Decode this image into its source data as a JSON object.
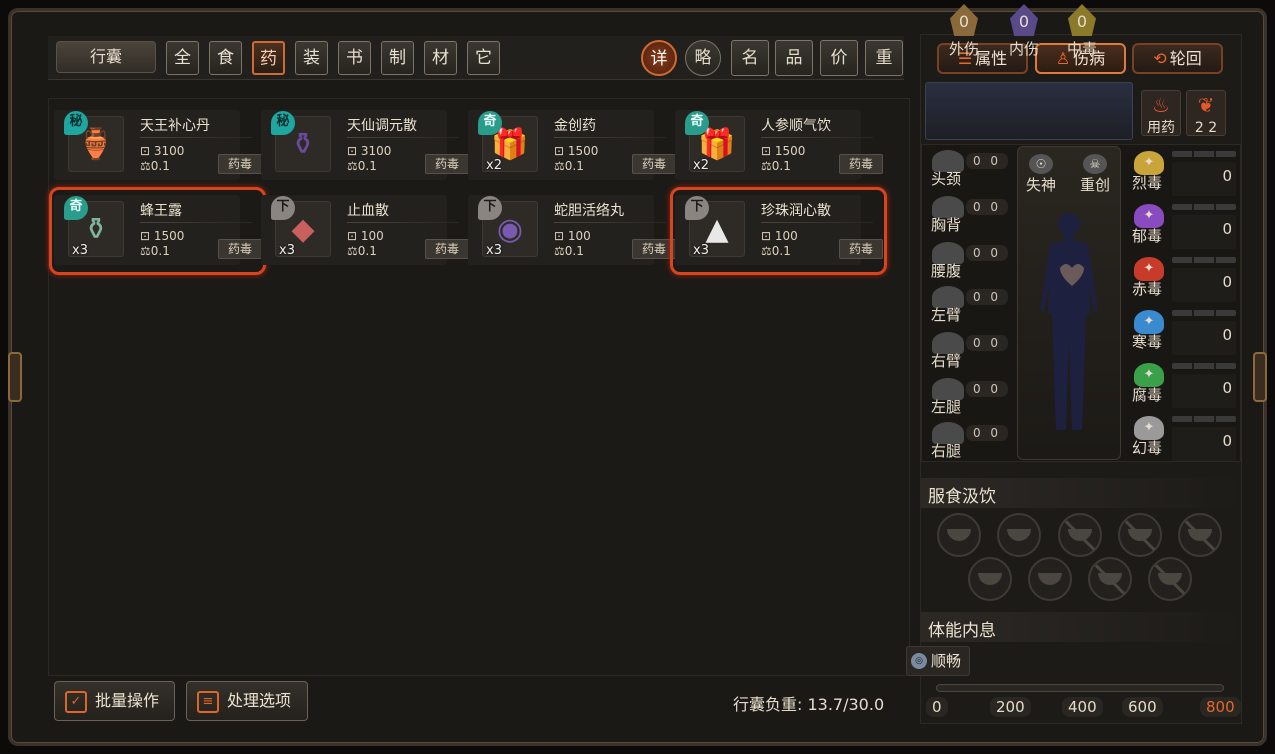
{
  "bag_tag": "行囊",
  "category_tabs": [
    {
      "label": "全",
      "active": false
    },
    {
      "label": "食",
      "active": false
    },
    {
      "label": "药",
      "active": true
    },
    {
      "label": "装",
      "active": false
    },
    {
      "label": "书",
      "active": false
    },
    {
      "label": "制",
      "active": false
    },
    {
      "label": "材",
      "active": false
    },
    {
      "label": "它",
      "active": false
    }
  ],
  "view_buttons": [
    {
      "label": "详",
      "active": true
    },
    {
      "label": "略",
      "active": false
    },
    {
      "label": "名",
      "active": false
    },
    {
      "label": "品",
      "active": false
    },
    {
      "label": "价",
      "active": false
    },
    {
      "label": "重",
      "active": false
    }
  ],
  "items": [
    {
      "name": "天王补心丹",
      "grade": "秘",
      "price": "3100",
      "weight": "0.1",
      "tag": "药毒",
      "qty": "",
      "selected": false,
      "icon": "red-bottle-icon"
    },
    {
      "name": "天仙调元散",
      "grade": "秘",
      "price": "3100",
      "weight": "0.1",
      "tag": "药毒",
      "qty": "",
      "selected": false,
      "icon": "purple-vase-icon"
    },
    {
      "name": "金创药",
      "grade": "奇",
      "price": "1500",
      "weight": "0.1",
      "tag": "药毒",
      "qty": "x2",
      "selected": false,
      "icon": "red-pouch-icon"
    },
    {
      "name": "人参顺气饮",
      "grade": "奇",
      "price": "1500",
      "weight": "0.1",
      "tag": "药毒",
      "qty": "x2",
      "selected": false,
      "icon": "purple-pouch-icon"
    },
    {
      "name": "蜂王露",
      "grade": "奇",
      "price": "1500",
      "weight": "0.1",
      "tag": "药毒",
      "qty": "x3",
      "selected": true,
      "icon": "green-vase-icon"
    },
    {
      "name": "止血散",
      "grade": "下",
      "price": "100",
      "weight": "0.1",
      "tag": "药毒",
      "qty": "x3",
      "selected": false,
      "icon": "powder-packet-icon"
    },
    {
      "name": "蛇胆活络丸",
      "grade": "下",
      "price": "100",
      "weight": "0.1",
      "tag": "药毒",
      "qty": "x3",
      "selected": false,
      "icon": "pill-plate-icon"
    },
    {
      "name": "珍珠润心散",
      "grade": "下",
      "price": "100",
      "weight": "0.1",
      "tag": "药毒",
      "qty": "x3",
      "selected": true,
      "icon": "white-powder-icon"
    }
  ],
  "bottom": {
    "batch_label": "批量操作",
    "options_label": "处理选项",
    "load_text": "行囊负重: 13.7/30.0"
  },
  "right_tabs": [
    {
      "label": "属性",
      "active": false
    },
    {
      "label": "伤病",
      "active": true
    },
    {
      "label": "轮回",
      "active": false
    }
  ],
  "injuries": [
    {
      "value": "0",
      "label": "外伤"
    },
    {
      "value": "0",
      "label": "内伤"
    },
    {
      "value": "0",
      "label": "中毒"
    }
  ],
  "use_medicine": {
    "label": "用药",
    "count": "2 2"
  },
  "body_parts": [
    {
      "label": "头颈",
      "values": "0 0"
    },
    {
      "label": "胸背",
      "values": "0 0"
    },
    {
      "label": "腰腹",
      "values": "0 0"
    },
    {
      "label": "左臂",
      "values": "0 0"
    },
    {
      "label": "右臂",
      "values": "0 0"
    },
    {
      "label": "左腿",
      "values": "0 0"
    },
    {
      "label": "右腿",
      "values": "0 0"
    }
  ],
  "mind": {
    "lose_spirit": "失神",
    "heavy_wound": "重创"
  },
  "poisons": [
    {
      "label": "烈毒",
      "value": "0",
      "color": "#c9a43a"
    },
    {
      "label": "郁毒",
      "value": "0",
      "color": "#8a4ac0"
    },
    {
      "label": "赤毒",
      "value": "0",
      "color": "#c83a2a"
    },
    {
      "label": "寒毒",
      "value": "0",
      "color": "#3a8ad0"
    },
    {
      "label": "腐毒",
      "value": "0",
      "color": "#3aa04a"
    },
    {
      "label": "幻毒",
      "value": "0",
      "color": "#9a9a9a"
    }
  ],
  "eat_section": {
    "title": "服食汲饮"
  },
  "stamina_section": {
    "title": "体能内息",
    "status": "顺畅",
    "ticks": [
      "0",
      "200",
      "400",
      "600",
      "800"
    ],
    "level": 0
  }
}
